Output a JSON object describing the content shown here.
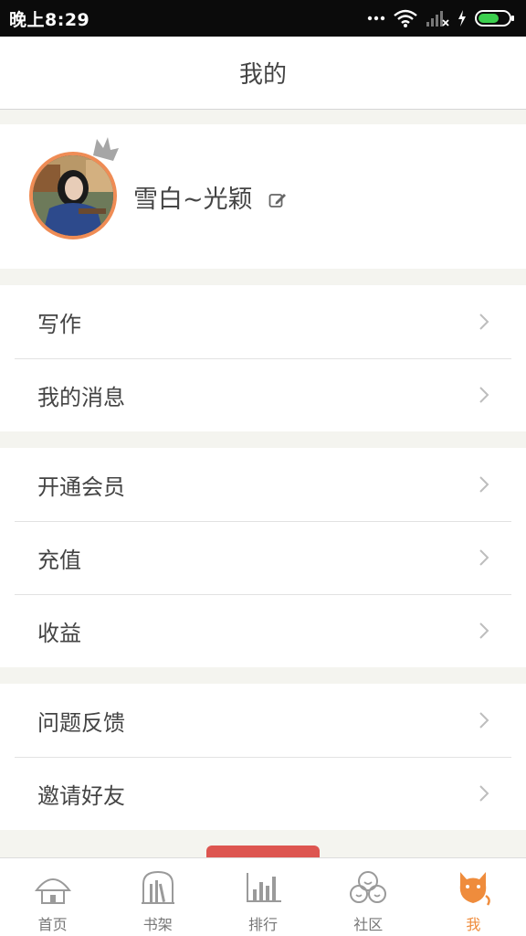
{
  "status_bar": {
    "time": "晚上8:29",
    "icons": [
      "more-dots-icon",
      "wifi-icon",
      "signal-icon",
      "charging-icon",
      "battery-icon"
    ]
  },
  "header": {
    "title": "我的"
  },
  "profile": {
    "username": "雪白~光颖",
    "avatar_border_color": "#ef8c55"
  },
  "menu_groups": [
    {
      "items": [
        {
          "label": "写作"
        },
        {
          "label": "我的消息"
        }
      ]
    },
    {
      "items": [
        {
          "label": "开通会员"
        },
        {
          "label": "充值"
        },
        {
          "label": "收益"
        }
      ]
    },
    {
      "items": [
        {
          "label": "问题反馈"
        },
        {
          "label": "邀请好友"
        }
      ]
    }
  ],
  "tab_bar": {
    "tabs": [
      {
        "label": "首页",
        "icon": "home-icon"
      },
      {
        "label": "书架",
        "icon": "bookshelf-icon"
      },
      {
        "label": "排行",
        "icon": "ranking-icon"
      },
      {
        "label": "社区",
        "icon": "community-icon"
      },
      {
        "label": "我",
        "icon": "me-icon",
        "active": true
      }
    ],
    "active_color": "#ef8c3c"
  },
  "colors": {
    "accent": "#ef8c3c",
    "button_red": "#dd5550",
    "background": "#f4f4ef"
  }
}
